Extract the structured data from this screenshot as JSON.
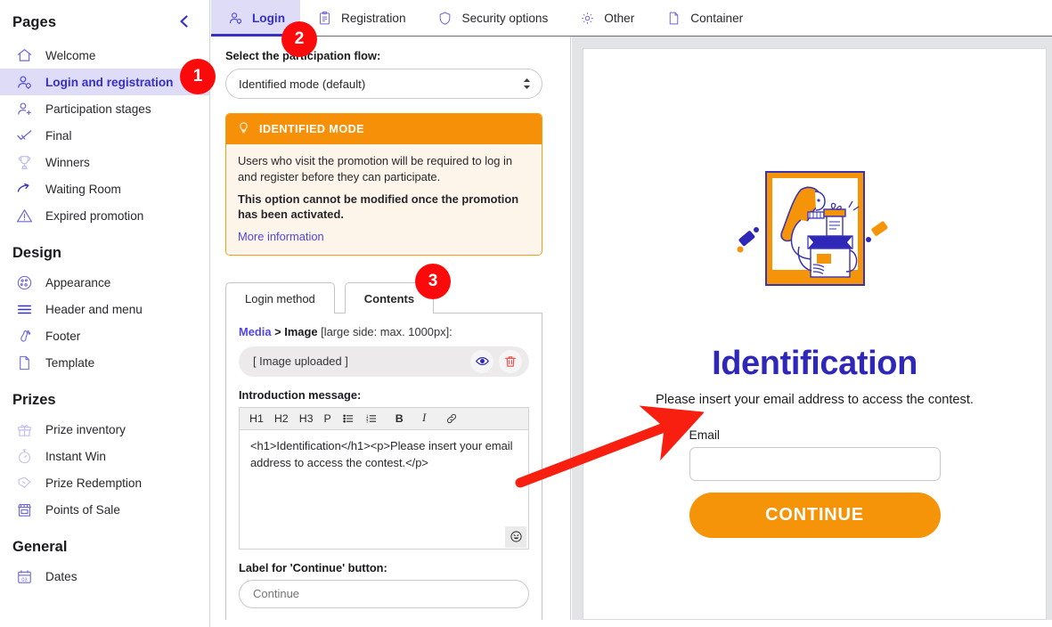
{
  "sidebar": {
    "header_title": "Pages",
    "collapse_icon": "chevron-left-icon",
    "groups": [
      {
        "title": null,
        "items": [
          {
            "label": "Welcome",
            "icon": "home-icon",
            "active": false,
            "dim": false
          },
          {
            "label": "Login and registration",
            "icon": "user-key-icon",
            "active": true,
            "dim": false
          },
          {
            "label": "Participation stages",
            "icon": "user-add-icon",
            "active": false,
            "dim": false
          },
          {
            "label": "Final",
            "icon": "check-badge-icon",
            "active": false,
            "dim": false
          },
          {
            "label": "Winners",
            "icon": "trophy-icon",
            "active": false,
            "dim": true
          },
          {
            "label": "Waiting Room",
            "icon": "hourglass-arrow-icon",
            "active": false,
            "dim": false
          },
          {
            "label": "Expired promotion",
            "icon": "warning-triangle-icon",
            "active": false,
            "dim": false
          }
        ]
      },
      {
        "title": "Design",
        "items": [
          {
            "label": "Appearance",
            "icon": "palette-icon",
            "active": false,
            "dim": false
          },
          {
            "label": "Header and menu",
            "icon": "menu-lines-icon",
            "active": false,
            "dim": false
          },
          {
            "label": "Footer",
            "icon": "footprint-icon",
            "active": false,
            "dim": false
          },
          {
            "label": "Template",
            "icon": "document-icon",
            "active": false,
            "dim": false
          }
        ]
      },
      {
        "title": "Prizes",
        "items": [
          {
            "label": "Prize inventory",
            "icon": "gift-icon",
            "active": false,
            "dim": true
          },
          {
            "label": "Instant Win",
            "icon": "stopwatch-icon",
            "active": false,
            "dim": true
          },
          {
            "label": "Prize Redemption",
            "icon": "ticket-icon",
            "active": false,
            "dim": true
          },
          {
            "label": "Points of Sale",
            "icon": "store-icon",
            "active": false,
            "dim": false
          }
        ]
      },
      {
        "title": "General",
        "items": [
          {
            "label": "Dates",
            "icon": "calendar-icon",
            "active": false,
            "dim": false
          }
        ]
      }
    ]
  },
  "tabs": [
    {
      "label": "Login",
      "icon": "user-key-icon",
      "active": true
    },
    {
      "label": "Registration",
      "icon": "clipboard-icon",
      "active": false
    },
    {
      "label": "Security options",
      "icon": "shield-icon",
      "active": false
    },
    {
      "label": "Other",
      "icon": "gear-icon",
      "active": false
    },
    {
      "label": "Container",
      "icon": "document-icon",
      "active": false
    }
  ],
  "edit_panel": {
    "flow_label": "Select the participation flow:",
    "flow_value": "Identified mode (default)",
    "callout": {
      "icon": "lightbulb-icon",
      "title": "IDENTIFIED MODE",
      "body_1": "Users who visit the promotion will be required to log in and register before they can participate.",
      "body_bold": "This option cannot be modified once the promotion has been activated.",
      "link": "More information"
    },
    "inner_tabs": [
      {
        "label": "Login method",
        "active": false
      },
      {
        "label": "Contents",
        "active": true
      }
    ],
    "media": {
      "breadcrumb_media": "Media",
      "breadcrumb_sep": ">",
      "breadcrumb_image": "Image",
      "breadcrumb_note": "[large side: max. 1000px]:",
      "uploaded_text": "[ Image uploaded ]",
      "preview_icon": "eye-icon",
      "delete_icon": "trash-icon"
    },
    "intro": {
      "label": "Introduction message:",
      "toolbar": [
        "H1",
        "H2",
        "H3",
        "P",
        "bullet-list-icon",
        "numbered-list-icon",
        "B",
        "I",
        "link-icon"
      ],
      "content": "<h1>Identification</h1><p>Please insert your email address to access the contest.</p>",
      "emoji_icon": "smiley-icon"
    },
    "continue_field": {
      "label": "Label for 'Continue' button:",
      "placeholder": "Continue",
      "value": ""
    }
  },
  "preview": {
    "heading": "Identification",
    "subtext": "Please insert your email address to access the contest.",
    "email_label": "Email",
    "email_value": "",
    "button_label": "CONTINUE"
  },
  "annotations": {
    "badges": [
      "1",
      "2",
      "3"
    ],
    "arrow_color": "#f81f10",
    "badge_color": "#fa0a0a"
  },
  "colors": {
    "accent_purple": "#3730c4",
    "accent_orange": "#f59408",
    "preview_heading": "#2f27b8"
  }
}
